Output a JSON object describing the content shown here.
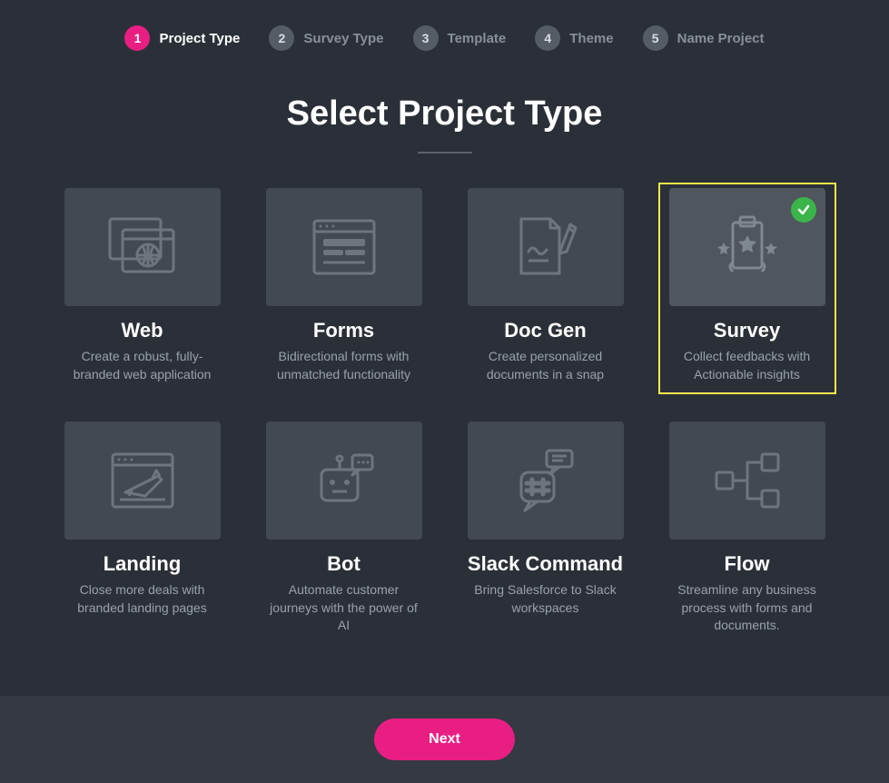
{
  "steps": [
    {
      "num": "1",
      "label": "Project Type",
      "active": true
    },
    {
      "num": "2",
      "label": "Survey Type",
      "active": false
    },
    {
      "num": "3",
      "label": "Template",
      "active": false
    },
    {
      "num": "4",
      "label": "Theme",
      "active": false
    },
    {
      "num": "5",
      "label": "Name Project",
      "active": false
    }
  ],
  "title": "Select Project Type",
  "cards": [
    {
      "title": "Web",
      "desc": "Create a robust, fully-branded web application",
      "icon": "web",
      "selected": false
    },
    {
      "title": "Forms",
      "desc": "Bidirectional forms with unmatched functionality",
      "icon": "forms",
      "selected": false
    },
    {
      "title": "Doc Gen",
      "desc": "Create personalized documents in a snap",
      "icon": "docgen",
      "selected": false
    },
    {
      "title": "Survey",
      "desc": "Collect feedbacks with Actionable insights",
      "icon": "survey",
      "selected": true
    },
    {
      "title": "Landing",
      "desc": "Close more deals with branded landing pages",
      "icon": "landing",
      "selected": false
    },
    {
      "title": "Bot",
      "desc": "Automate customer journeys with the power of AI",
      "icon": "bot",
      "selected": false
    },
    {
      "title": "Slack Command",
      "desc": "Bring Salesforce to Slack workspaces",
      "icon": "slack",
      "selected": false
    },
    {
      "title": "Flow",
      "desc": "Streamline any business process with forms and documents.",
      "icon": "flow",
      "selected": false
    }
  ],
  "next_label": "Next",
  "colors": {
    "accent": "#e91e83",
    "highlight": "#f6e84b",
    "success": "#3bb44a"
  }
}
